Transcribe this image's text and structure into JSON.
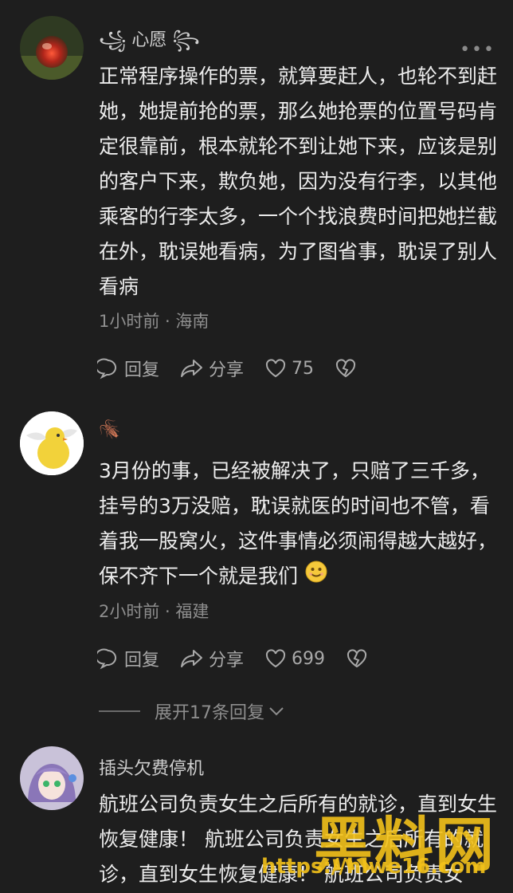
{
  "comments": [
    {
      "username": "心愿",
      "text": "正常程序操作的票，就算要赶人，也轮不到赶她，她提前抢的票，那么她抢票的位置号码肯定很靠前，根本就轮不到让她下来，应该是别的客户下来，欺负她，因为没有行李，以其他乘客的行李太多，一个个找浪费时间把她拦截在外，耽误她看病，为了图省事，耽误了别人看病",
      "time": "1小时前 · 海南",
      "reply_label": "回复",
      "share_label": "分享",
      "likes": "75"
    },
    {
      "username": "",
      "text": "3月份的事，已经被解决了，只赔了三千多，挂号的3万没赔，耽误就医的时间也不管，看着我一股窝火，这件事情必须闹得越大越好，保不齐下一个就是我们",
      "time": "2小时前 · 福建",
      "reply_label": "回复",
      "share_label": "分享",
      "likes": "699"
    },
    {
      "username": "插头欠费停机",
      "text": "航班公司负责女生之后所有的就诊，直到女生恢复健康！ 航班公司负责女生之后所有的就诊，直到女生恢复健康！ 航班公司负责女"
    }
  ],
  "expand_label": "展开17条回复",
  "watermark": {
    "title": "黑料网",
    "url": "https://hlwe16.com"
  }
}
